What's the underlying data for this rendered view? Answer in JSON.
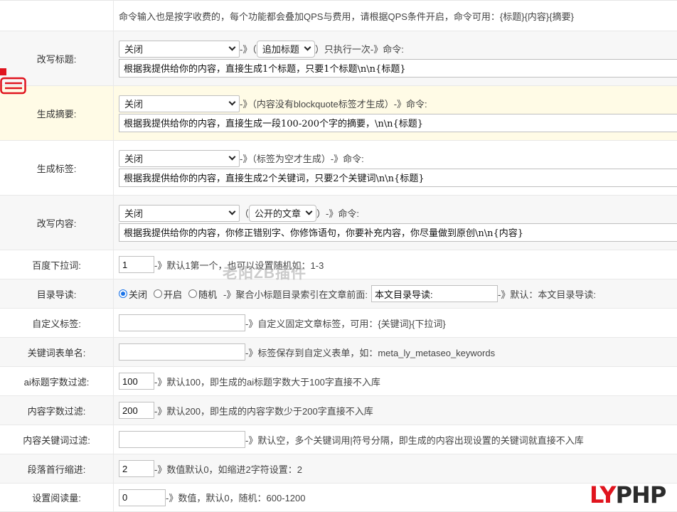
{
  "intro": "命令输入也是按字收费的，每个功能都会叠加QPS与费用，请根据QPS条件开启，命令可用：{标题}{内容}{摘要}",
  "rewrite_title": {
    "label": "改写标题:",
    "select": "关闭",
    "sep1": "-》（",
    "sub_select": "追加标题",
    "note": "）只执行一次-》命令:",
    "command": "根据我提供给你的内容，直接生成1个标题，只要1个标题\\n\\n{标题}"
  },
  "summary": {
    "label": "生成摘要:",
    "select": "关闭",
    "note": "-》（内容没有blockquote标签才生成）-》命令:",
    "command": "根据我提供给你的内容，直接生成一段100-200个字的摘要，\\n\\n{标题}"
  },
  "tags": {
    "label": "生成标签:",
    "select": "关闭",
    "note": "-》（标签为空才生成）-》命令:",
    "command": "根据我提供给你的内容，直接生成2个关键词，只要2个关键词\\n\\n{标题}"
  },
  "rewrite_content": {
    "label": "改写内容:",
    "select": "关闭",
    "sep1": "（",
    "sub_select": "公开的文章",
    "note": "）-》命令:",
    "command": "根据我提供给你的内容，你修正错别字、你修饰语句，你要补充内容，你尽量做到原创\\n\\n{内容}"
  },
  "baidu": {
    "label": "百度下拉词:",
    "value": "1",
    "note": "-》默认1第一个，也可以设置随机如：1-3"
  },
  "toc": {
    "label": "目录导读:",
    "options": [
      "关闭",
      "开启",
      "随机"
    ],
    "note": "-》聚合小标题目录索引在文章前面:",
    "value": "本文目录导读:",
    "default_note": "-》默认：本文目录导读:"
  },
  "custom_tag": {
    "label": "自定义标签:",
    "value": "",
    "note": "-》自定义固定文章标签，可用：{关键词}{下拉词}"
  },
  "kw_meta": {
    "label": "关键词表单名:",
    "value": "",
    "note": "-》标签保存到自定义表单，如：meta_ly_metaseo_keywords"
  },
  "ai_title_filter": {
    "label": "ai标题字数过滤:",
    "value": "100",
    "note": "-》默认100，即生成的ai标题字数大于100字直接不入库"
  },
  "content_len_filter": {
    "label": "内容字数过滤:",
    "value": "200",
    "note": "-》默认200，即生成的内容字数少于200字直接不入库"
  },
  "content_kw_filter": {
    "label": "内容关键词过滤:",
    "value": "",
    "note": "-》默认空，多个关键词用|符号分隔，即生成的内容出现设置的关键词就直接不入库"
  },
  "indent": {
    "label": "段落首行缩进:",
    "value": "2",
    "note": "-》数值默认0，如缩进2字符设置：2"
  },
  "views": {
    "label": "设置阅读量:",
    "value": "0",
    "note": "-》数值，默认0，随机：600-1200"
  },
  "watermark": "老阳ZB插件",
  "logo": {
    "ly": "LY",
    "php": "PHP"
  },
  "colors": {
    "brand_red": "#e0141e",
    "radio_blue": "#1a73e8",
    "highlight_row": "#fffbe6"
  }
}
